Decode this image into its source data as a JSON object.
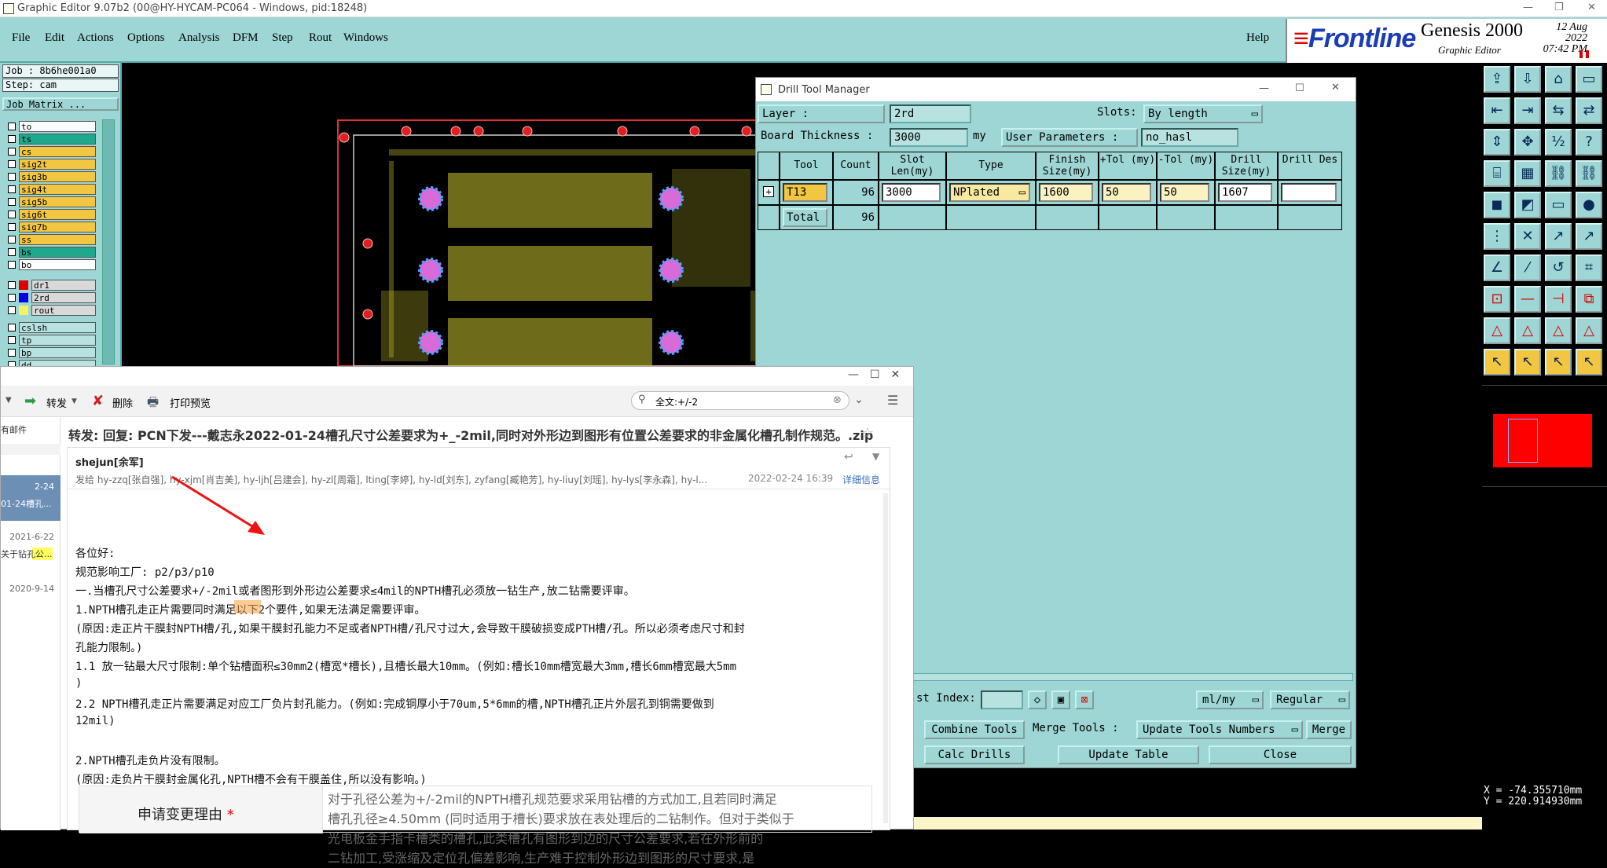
{
  "window": {
    "title": "Graphic Editor 9.07b2 (00@HY-HYCAM-PC064 - Windows, pid:18248)"
  },
  "menubar": {
    "items": [
      "File",
      "Edit",
      "Actions",
      "Options",
      "Analysis",
      "DFM",
      "Step",
      "Rout",
      "Windows"
    ],
    "help": "Help"
  },
  "brand": {
    "logo": "Frontline",
    "product": "Genesis 2000",
    "subtitle": "Graphic Editor",
    "date": "12 Aug 2022",
    "time": "07:42 PM"
  },
  "left": {
    "job": "Job : 8b6he001a0",
    "step": "Step: cam",
    "matrix": "Job Matrix ...",
    "layers_a": [
      {
        "name": "to",
        "color": "#ffffff"
      },
      {
        "name": "ts",
        "color": "#1fa88c"
      },
      {
        "name": "cs",
        "color": "#f2c640"
      },
      {
        "name": "sig2t",
        "color": "#f2c640"
      },
      {
        "name": "sig3b",
        "color": "#f2c640"
      },
      {
        "name": "sig4t",
        "color": "#f2c640"
      },
      {
        "name": "sig5b",
        "color": "#f2c640"
      },
      {
        "name": "sig6t",
        "color": "#f2c640"
      },
      {
        "name": "sig7b",
        "color": "#f2c640"
      },
      {
        "name": "ss",
        "color": "#f2c640"
      },
      {
        "name": "bs",
        "color": "#1fa88c"
      },
      {
        "name": "bo",
        "color": "#ffffff"
      }
    ],
    "layers_b": [
      {
        "name": "dr1",
        "swatch": "#e00000"
      },
      {
        "name": "2rd",
        "swatch": "#0000e0"
      },
      {
        "name": "rout",
        "swatch": "#f7f060"
      }
    ],
    "layers_c": [
      "cslsh",
      "tp",
      "bp",
      "dd"
    ]
  },
  "dtm": {
    "title": "Drill Tool Manager",
    "layer_label": "Layer             :",
    "layer_value": "2rd",
    "slots_label": "Slots:",
    "slots_value": "By length",
    "thickness_label": "Board Thickness :",
    "thickness_value": "3000",
    "thickness_unit": "my",
    "userparams_label": "User Parameters :",
    "userparams_value": "no_hasl",
    "headers": [
      "Tool",
      "Count",
      "Slot Len(my)",
      "Type",
      "Finish Size(my)",
      "+Tol (my)",
      "-Tol (my)",
      "Drill Size(my)",
      "Drill Des"
    ],
    "row": {
      "tool": "T13",
      "count": "96",
      "slot_len": "3000",
      "type": "NPlated",
      "finish": "1600",
      "plus_tol": "50",
      "minus_tol": "50",
      "drill": "1607",
      "des": ""
    },
    "total": {
      "label": "Total",
      "count": "96"
    },
    "index_label": "st Index:",
    "units": "ml/my",
    "mode": "Regular",
    "combine": "Combine Tools",
    "merge_label": "Merge Tools :",
    "update_numbers": "Update Tools Numbers",
    "merge": "Merge",
    "calc": "Calc Drills",
    "update_table": "Update Table",
    "close": "Close"
  },
  "coords": {
    "x": "X = -74.355710mm",
    "y": "Y = 220.914930mm"
  },
  "mail": {
    "forward": "转发",
    "delete": "删除",
    "print": "打印预览",
    "search": "全文:+/-2",
    "folder": "有邮件",
    "list": [
      {
        "date": "2-24",
        "text": "01-24槽孔..."
      },
      {
        "date": "2021-6-22",
        "text": "关于钻孔公..."
      },
      {
        "date": "2020-9-14",
        "text": ""
      }
    ],
    "subject": "转发: 回复: PCN下发---戴志永2022-01-24槽孔尺寸公差要求为+_-2mil,同时对外形边到图形有位置公差要求的非金属化槽孔制作规范。.zip",
    "sender": "shejun[余军]",
    "recipients": "发给 hy-zzq[张自强], hy-xjm[肖吉美], hy-ljh[吕建会], hy-zl[周霜], lting[李婷], hy-ld[刘东], zyfang[臧艳芳], hy-liuy[刘瑶], hy-lys[李永森], hy-l...",
    "date": "2022-02-24 16:39",
    "detail": "详细信息",
    "lines": [
      "各位好:",
      "    规范影响工厂: p2/p3/p10",
      "    一.当槽孔尺寸公差要求+/-2mil或者图形到外形边公差要求≤4mil的NPTH槽孔必须放一钻生产,放二钻需要评审。",
      "     1.NPTH槽孔走正片需要同时满足以下2个要件,如果无法满足需要评审。",
      "     (原因:走正片干膜封NPTH槽/孔,如果干膜封孔能力不足或者NPTH槽/孔尺寸过大,会导致干膜破损变成PTH槽/孔。所以必须考虑尺寸和封",
      "孔能力限制。)",
      "          1.1 放一钻最大尺寸限制:单个钻槽面积≤30mm2(槽宽*槽长),且槽长最大10mm。(例如:槽长10mm槽宽最大3mm,槽长6mm槽宽最大5mm",
      ")",
      "          2.2 NPTH槽孔走正片需要满足对应工厂负片封孔能力。(例如:完成铜厚小于70um,5*6mm的槽,NPTH槽孔正片外层孔到铜需要做到",
      "12mil)",
      "",
      "     2.NPTH槽孔走负片没有限制。",
      "     (原因:走负片干膜封金属化孔,NPTH槽不会有干膜盖住,所以没有影响。)"
    ],
    "reason_label": "申请变更理由",
    "reason_text": [
      "对于孔径公差为+/-2mil的NPTH槽孔规范要求采用钻槽的方式加工,且若同时满足",
      "槽孔孔径≥4.50mm (同时适用于槽长)要求放在表处理后的二钻制作。但对于类似于",
      "光电板金手指卡槽类的槽孔,此类槽孔有图形到边的尺寸公差要求,若在外形前的",
      "二钻加工,受涨缩及定位孔偏差影响,生产难于控制外形边到图形的尺寸要求,是"
    ]
  }
}
